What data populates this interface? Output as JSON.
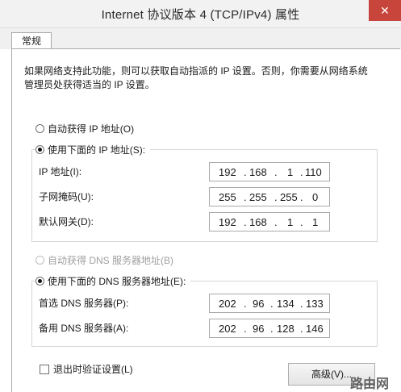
{
  "window": {
    "title": "Internet 协议版本 4 (TCP/IPv4) 属性",
    "close_glyph": "✕"
  },
  "tabs": [
    {
      "label": "常规"
    }
  ],
  "description": "如果网络支持此功能，则可以获取自动指派的 IP 设置。否则，你需要从网络系统管理员处获得适当的 IP 设置。",
  "ip_section": {
    "auto_label": "自动获得 IP 地址(O)",
    "manual_label": "使用下面的 IP 地址(S):",
    "selected": "manual",
    "fields": [
      {
        "label": "IP 地址(I):",
        "octets": [
          "192",
          "168",
          "1",
          "110"
        ]
      },
      {
        "label": "子网掩码(U):",
        "octets": [
          "255",
          "255",
          "255",
          "0"
        ]
      },
      {
        "label": "默认网关(D):",
        "octets": [
          "192",
          "168",
          "1",
          "1"
        ]
      }
    ]
  },
  "dns_section": {
    "auto_label": "自动获得 DNS 服务器地址(B)",
    "manual_label": "使用下面的 DNS 服务器地址(E):",
    "selected": "manual",
    "auto_disabled": true,
    "fields": [
      {
        "label": "首选 DNS 服务器(P):",
        "octets": [
          "202",
          "96",
          "134",
          "133"
        ]
      },
      {
        "label": "备用 DNS 服务器(A):",
        "octets": [
          "202",
          "96",
          "128",
          "146"
        ]
      }
    ]
  },
  "validate": {
    "label": "退出时验证设置(L)",
    "checked": false
  },
  "advanced_button": {
    "label": "高级(V)..."
  },
  "watermark": "路由网"
}
